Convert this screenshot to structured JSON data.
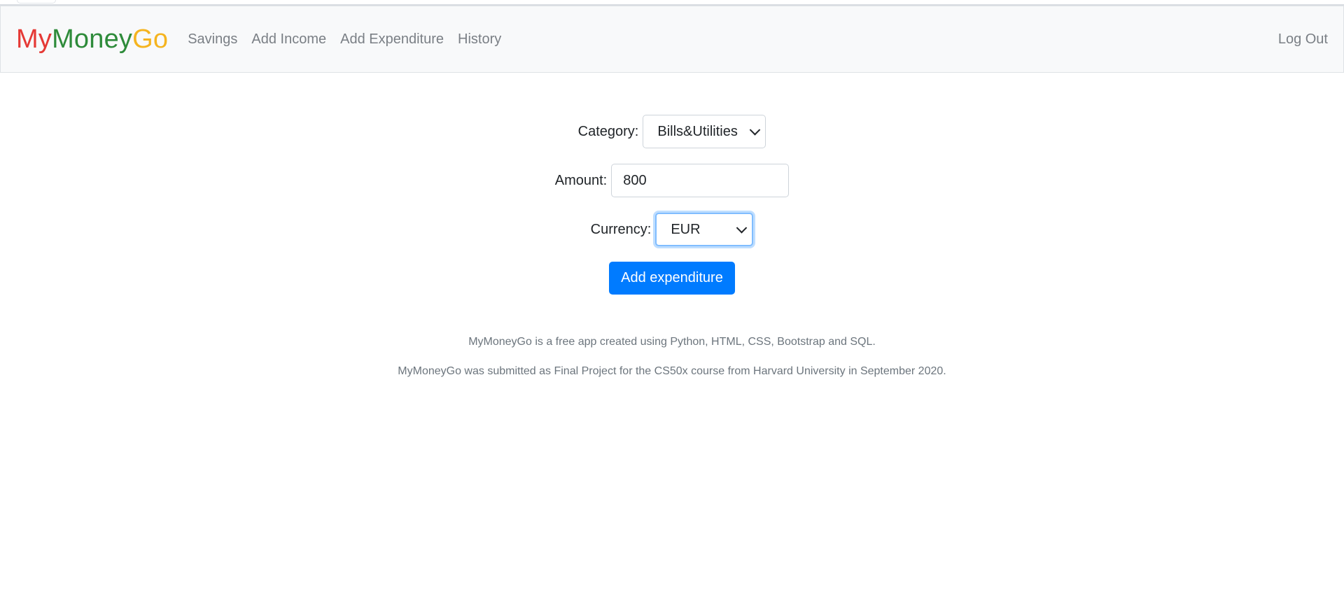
{
  "brand": {
    "part1": "My",
    "part2": "Money",
    "part3": "Go",
    "colors": {
      "part1": "#e53935",
      "part2": "#2e8b3a",
      "part3": "#f5b41f"
    }
  },
  "nav": {
    "items": [
      {
        "label": "Savings"
      },
      {
        "label": "Add Income"
      },
      {
        "label": "Add Expenditure"
      },
      {
        "label": "History"
      }
    ],
    "logout_label": "Log Out"
  },
  "form": {
    "category_label": "Category:",
    "category_value": "Bills&Utilities",
    "amount_label": "Amount:",
    "amount_value": "800",
    "currency_label": "Currency:",
    "currency_value": "EUR",
    "submit_label": "Add expenditure"
  },
  "footer": {
    "line1": "MyMoneyGo is a free app created using Python, HTML, CSS, Bootstrap and SQL.",
    "line2": "MyMoneyGo was submitted as Final Project for the CS50x course from Harvard University in September 2020."
  },
  "colors": {
    "primary": "#007bff",
    "navbar_bg": "#f8f9fa",
    "muted_text": "#6c757d"
  }
}
